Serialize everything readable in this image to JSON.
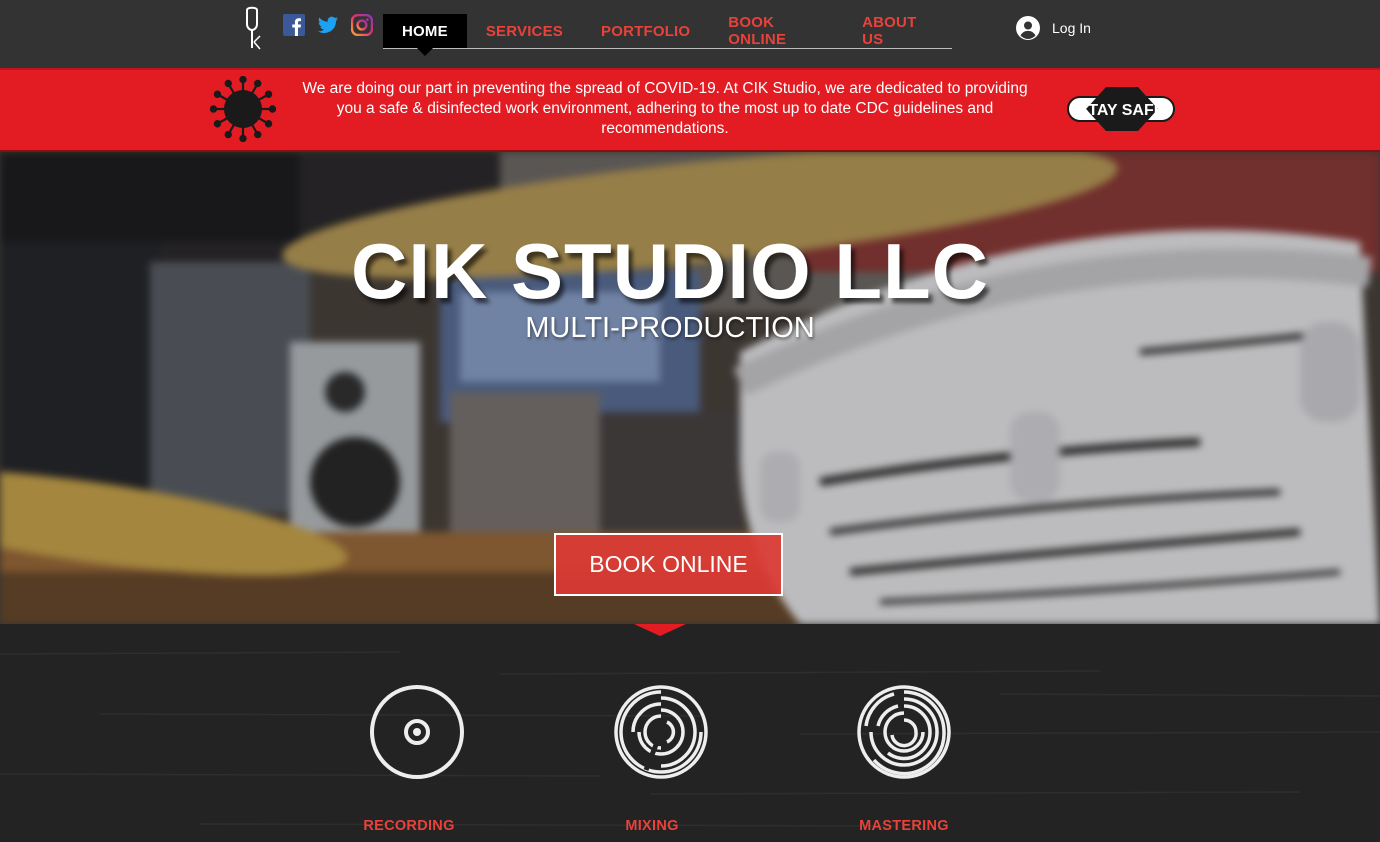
{
  "header": {
    "logo_icon": "tuning-fork-k-logo",
    "social": [
      "facebook-icon",
      "twitter-icon",
      "instagram-icon"
    ],
    "nav": [
      {
        "label": "HOME",
        "active": true
      },
      {
        "label": "SERVICES"
      },
      {
        "label": "PORTFOLIO"
      },
      {
        "label": "BOOK ONLINE"
      },
      {
        "label": "ABOUT US"
      }
    ],
    "login_label": "Log In"
  },
  "banner": {
    "text": "We are doing our part in preventing the spread of COVID-19. At CIK Studio, we are dedicated to providing you a safe & disinfected work environment, adhering to the most up to date CDC guidelines and recommendations.",
    "badge": "STAY SAFE"
  },
  "hero": {
    "title": "CIK STUDIO LLC",
    "subtitle": "MULTI-PRODUCTION",
    "cta_label": "BOOK ONLINE"
  },
  "services": [
    {
      "label": "RECORDING",
      "icon": "vinyl-record-icon"
    },
    {
      "label": "MIXING",
      "icon": "mixing-rings-icon"
    },
    {
      "label": "MASTERING",
      "icon": "mastering-rings-icon"
    }
  ],
  "colors": {
    "accent": "#e8423a",
    "banner": "#e31c23",
    "header": "#333333",
    "dark": "#232323"
  }
}
